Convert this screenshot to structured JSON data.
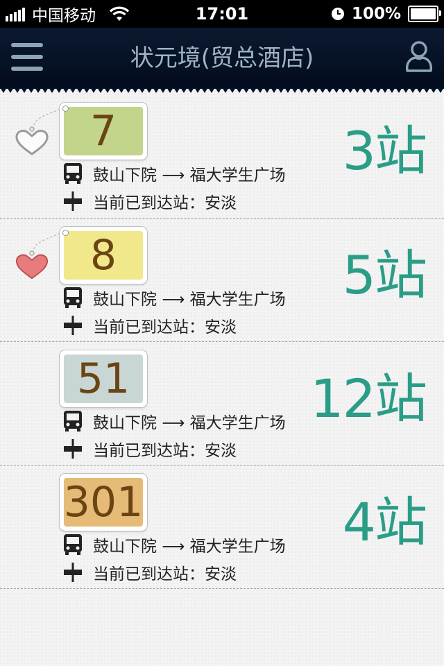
{
  "status_bar": {
    "carrier": "中国移动",
    "time": "17:01",
    "battery_percent": "100%"
  },
  "nav": {
    "title": "状元境(贸总酒店)"
  },
  "colors": {
    "navbar": "#04112a",
    "stops_text": "#2a9d86",
    "route_text": "#6b4511",
    "heart_favorite": "#e77c7e"
  },
  "routes": [
    {
      "number": "7",
      "tag_color": "#c3d48b",
      "favorite": false,
      "direction": "鼓山下院 ⟶ 福大学生广场",
      "current_label": "当前已到达站：",
      "current_station": "安淡",
      "stops": "3站"
    },
    {
      "number": "8",
      "tag_color": "#f1e88c",
      "favorite": true,
      "direction": "鼓山下院 ⟶ 福大学生广场",
      "current_label": "当前已到达站：",
      "current_station": "安淡",
      "stops": "5站"
    },
    {
      "number": "51",
      "tag_color": "#c8d6d6",
      "favorite": null,
      "direction": "鼓山下院 ⟶ 福大学生广场",
      "current_label": "当前已到达站：",
      "current_station": "安淡",
      "stops": "12站"
    },
    {
      "number": "301",
      "tag_color": "#e6bb78",
      "favorite": null,
      "direction": "鼓山下院 ⟶ 福大学生广场",
      "current_label": "当前已到达站：",
      "current_station": "安淡",
      "stops": "4站"
    }
  ],
  "icons": {
    "menu": "menu-icon",
    "user": "user-icon",
    "bus": "bus-icon",
    "station": "station-icon",
    "heart_outline": "heart-outline-icon",
    "heart_filled": "heart-filled-icon"
  }
}
